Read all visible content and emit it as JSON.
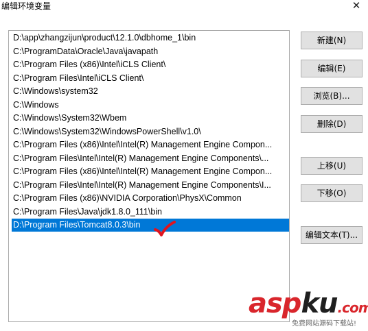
{
  "window": {
    "title": "编辑环境变量",
    "close_glyph": "✕"
  },
  "path_list": [
    "D:\\app\\zhangzijun\\product\\12.1.0\\dbhome_1\\bin",
    "C:\\ProgramData\\Oracle\\Java\\javapath",
    "C:\\Program Files (x86)\\Intel\\iCLS Client\\",
    "C:\\Program Files\\Intel\\iCLS Client\\",
    "C:\\Windows\\system32",
    "C:\\Windows",
    "C:\\Windows\\System32\\Wbem",
    "C:\\Windows\\System32\\WindowsPowerShell\\v1.0\\",
    "C:\\Program Files (x86)\\Intel\\Intel(R) Management Engine Compon...",
    "C:\\Program Files\\Intel\\Intel(R) Management Engine Components\\...",
    "C:\\Program Files (x86)\\Intel\\Intel(R) Management Engine Compon...",
    "C:\\Program Files\\Intel\\Intel(R) Management Engine Components\\I...",
    "C:\\Program Files (x86)\\NVIDIA Corporation\\PhysX\\Common",
    "C:\\Program Files\\Java\\jdk1.8.0_111\\bin",
    "D:\\Program Files\\Tomcat8.0.3\\bin"
  ],
  "selected_index": 14,
  "buttons": {
    "new": "新建(N)",
    "edit": "编辑(E)",
    "browse": "浏览(B)...",
    "delete": "删除(D)",
    "move_up": "上移(U)",
    "move_down": "下移(O)",
    "edit_text": "编辑文本(T)..."
  },
  "watermark": {
    "part1": "asp",
    "part2": "ku",
    "part3": ".com",
    "tagline": "免费网站源码下载站!"
  },
  "colors": {
    "selection": "#0078d7",
    "check": "#e0141e",
    "watermark_red": "#d9262c"
  }
}
